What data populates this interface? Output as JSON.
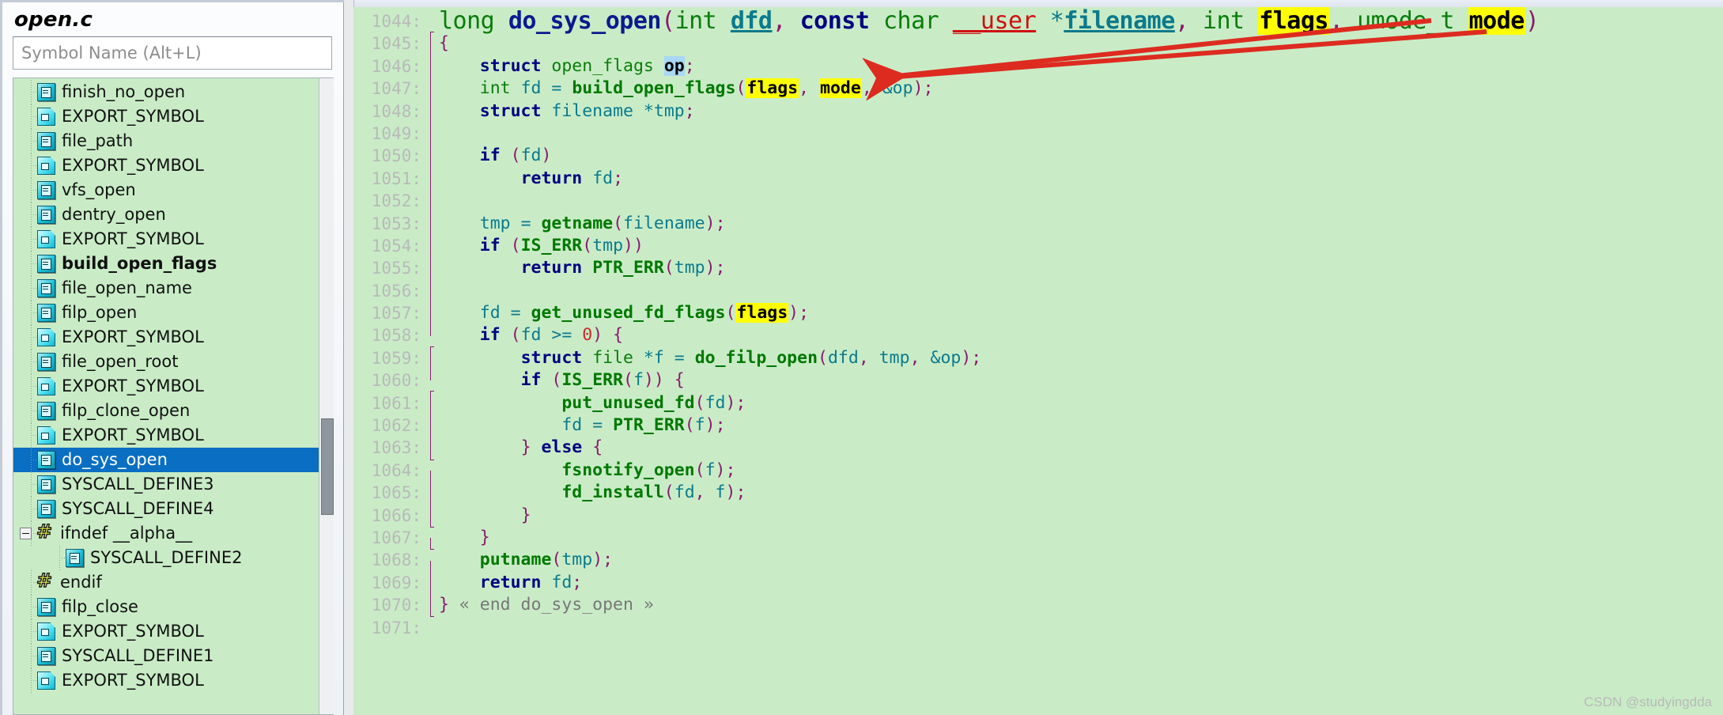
{
  "window": {
    "file_title": "open.c"
  },
  "search": {
    "placeholder": "Symbol Name (Alt+L)",
    "value": ""
  },
  "symbol_tree": {
    "items": [
      {
        "label": "finish_no_open",
        "icon": "symbol-icon",
        "depth": 0,
        "bold": false,
        "selected": false,
        "expander": null
      },
      {
        "label": "EXPORT_SYMBOL",
        "icon": "macro-icon",
        "depth": 0,
        "bold": false,
        "selected": false,
        "expander": null
      },
      {
        "label": "file_path",
        "icon": "symbol-icon",
        "depth": 0,
        "bold": false,
        "selected": false,
        "expander": null
      },
      {
        "label": "EXPORT_SYMBOL",
        "icon": "macro-icon",
        "depth": 0,
        "bold": false,
        "selected": false,
        "expander": null
      },
      {
        "label": "vfs_open",
        "icon": "symbol-icon",
        "depth": 0,
        "bold": false,
        "selected": false,
        "expander": null
      },
      {
        "label": "dentry_open",
        "icon": "symbol-icon",
        "depth": 0,
        "bold": false,
        "selected": false,
        "expander": null
      },
      {
        "label": "EXPORT_SYMBOL",
        "icon": "macro-icon",
        "depth": 0,
        "bold": false,
        "selected": false,
        "expander": null
      },
      {
        "label": "build_open_flags",
        "icon": "symbol-icon",
        "depth": 0,
        "bold": true,
        "selected": false,
        "expander": null
      },
      {
        "label": "file_open_name",
        "icon": "symbol-icon",
        "depth": 0,
        "bold": false,
        "selected": false,
        "expander": null
      },
      {
        "label": "filp_open",
        "icon": "symbol-icon",
        "depth": 0,
        "bold": false,
        "selected": false,
        "expander": null
      },
      {
        "label": "EXPORT_SYMBOL",
        "icon": "macro-icon",
        "depth": 0,
        "bold": false,
        "selected": false,
        "expander": null
      },
      {
        "label": "file_open_root",
        "icon": "symbol-icon",
        "depth": 0,
        "bold": false,
        "selected": false,
        "expander": null
      },
      {
        "label": "EXPORT_SYMBOL",
        "icon": "macro-icon",
        "depth": 0,
        "bold": false,
        "selected": false,
        "expander": null
      },
      {
        "label": "filp_clone_open",
        "icon": "symbol-icon",
        "depth": 0,
        "bold": false,
        "selected": false,
        "expander": null
      },
      {
        "label": "EXPORT_SYMBOL",
        "icon": "macro-icon",
        "depth": 0,
        "bold": false,
        "selected": false,
        "expander": null
      },
      {
        "label": "do_sys_open",
        "icon": "symbol-icon",
        "depth": 0,
        "bold": false,
        "selected": true,
        "expander": null
      },
      {
        "label": "SYSCALL_DEFINE3",
        "icon": "symbol-icon",
        "depth": 0,
        "bold": false,
        "selected": false,
        "expander": null
      },
      {
        "label": "SYSCALL_DEFINE4",
        "icon": "symbol-icon",
        "depth": 0,
        "bold": false,
        "selected": false,
        "expander": null
      },
      {
        "label": "ifndef __alpha__",
        "icon": "preprocessor-icon",
        "depth": 0,
        "bold": false,
        "selected": false,
        "expander": "collapse"
      },
      {
        "label": "SYSCALL_DEFINE2",
        "icon": "symbol-icon",
        "depth": 1,
        "bold": false,
        "selected": false,
        "expander": null
      },
      {
        "label": "endif",
        "icon": "preprocessor-icon",
        "depth": 0,
        "bold": false,
        "selected": false,
        "expander": null
      },
      {
        "label": "filp_close",
        "icon": "symbol-icon",
        "depth": 0,
        "bold": false,
        "selected": false,
        "expander": null
      },
      {
        "label": "EXPORT_SYMBOL",
        "icon": "macro-icon",
        "depth": 0,
        "bold": false,
        "selected": false,
        "expander": null
      },
      {
        "label": "SYSCALL_DEFINE1",
        "icon": "symbol-icon",
        "depth": 0,
        "bold": false,
        "selected": false,
        "expander": null
      },
      {
        "label": "EXPORT_SYMBOL",
        "icon": "macro-icon",
        "depth": 0,
        "bold": false,
        "selected": false,
        "expander": null
      }
    ]
  },
  "editor": {
    "first_line": 1044,
    "last_line": 1071,
    "lines": [
      {
        "n": "1044",
        "text": "long do_sys_open(int dfd, const char __user *filename, int flags, umode_t mode)"
      },
      {
        "n": "1045",
        "text": "{"
      },
      {
        "n": "1046",
        "text": "    struct open_flags op;"
      },
      {
        "n": "1047",
        "text": "    int fd = build_open_flags(flags, mode, &op);"
      },
      {
        "n": "1048",
        "text": "    struct filename *tmp;"
      },
      {
        "n": "1049",
        "text": ""
      },
      {
        "n": "1050",
        "text": "    if (fd)"
      },
      {
        "n": "1051",
        "text": "        return fd;"
      },
      {
        "n": "1052",
        "text": ""
      },
      {
        "n": "1053",
        "text": "    tmp = getname(filename);"
      },
      {
        "n": "1054",
        "text": "    if (IS_ERR(tmp))"
      },
      {
        "n": "1055",
        "text": "        return PTR_ERR(tmp);"
      },
      {
        "n": "1056",
        "text": ""
      },
      {
        "n": "1057",
        "text": "    fd = get_unused_fd_flags(flags);"
      },
      {
        "n": "1058",
        "text": "    if (fd >= 0) {"
      },
      {
        "n": "1059",
        "text": "        struct file *f = do_filp_open(dfd, tmp, &op);"
      },
      {
        "n": "1060",
        "text": "        if (IS_ERR(f)) {"
      },
      {
        "n": "1061",
        "text": "            put_unused_fd(fd);"
      },
      {
        "n": "1062",
        "text": "            fd = PTR_ERR(f);"
      },
      {
        "n": "1063",
        "text": "        } else {"
      },
      {
        "n": "1064",
        "text": "            fsnotify_open(f);"
      },
      {
        "n": "1065",
        "text": "            fd_install(fd, f);"
      },
      {
        "n": "1066",
        "text": "        }"
      },
      {
        "n": "1067",
        "text": "    }"
      },
      {
        "n": "1068",
        "text": "    putname(tmp);"
      },
      {
        "n": "1069",
        "text": "    return fd;"
      },
      {
        "n": "1070",
        "text": "} « end do_sys_open »"
      },
      {
        "n": "1071",
        "text": ""
      }
    ],
    "highlighted_tokens": [
      "flags",
      "mode"
    ],
    "selected_token": "op",
    "fold_comment": "« end do_sys_open »"
  },
  "annotations": {
    "arrow_count": 2,
    "arrow_color": "#dd2b20",
    "description": "two red arrows pointing from flags and mode parameters to line 1047"
  },
  "watermark": {
    "text": "CSDN @studyingdda"
  },
  "colors": {
    "code_background": "#c9ecc7",
    "selection_blue": "#0a6fc2",
    "highlight_yellow": "#ffff00",
    "token_highlight_blue": "#a8d8f5",
    "keyword": "#000080",
    "type": "#0a7d0a",
    "function": "#007800",
    "variable": "#0b7a8c",
    "punctuation": "#8a1a6e",
    "macro_red": "#d01010",
    "line_number": "#b9b9b9"
  }
}
